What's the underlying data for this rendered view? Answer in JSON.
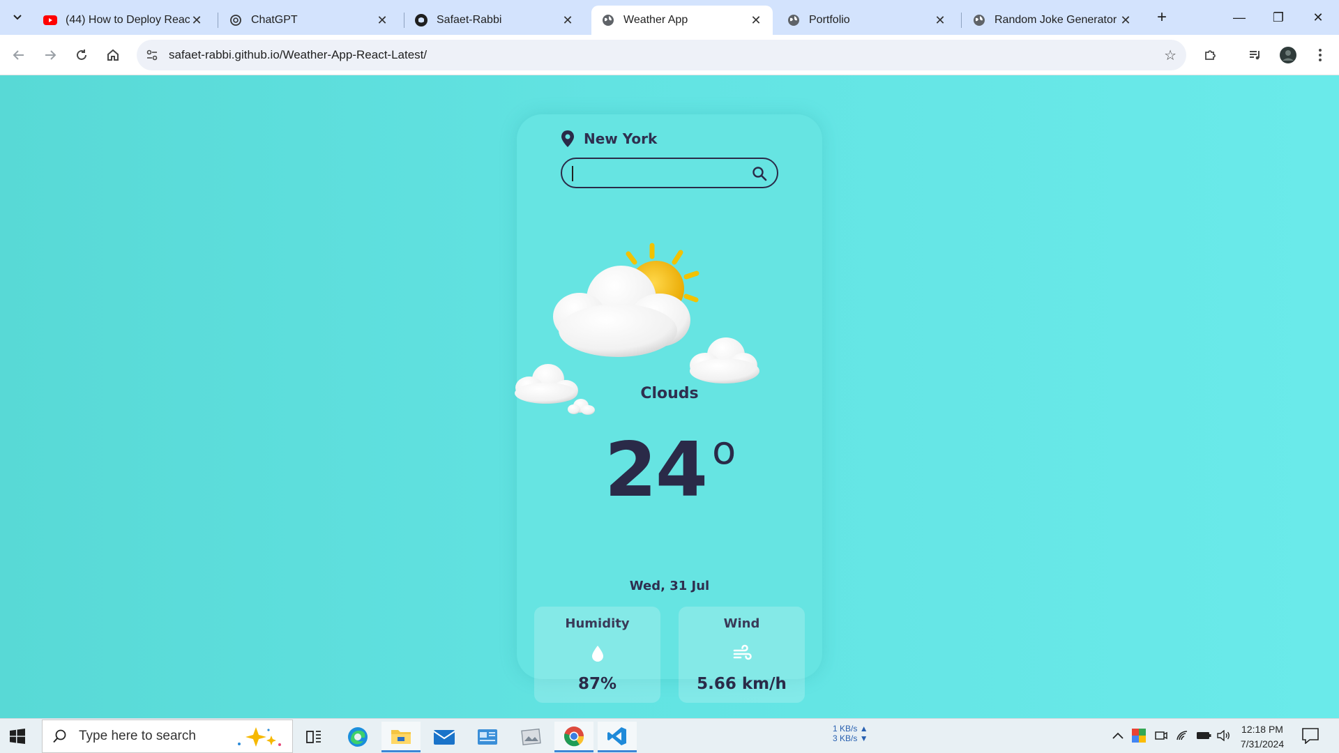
{
  "browser": {
    "tabs": [
      {
        "title": "(44) How to Deploy React /",
        "favicon": "youtube-icon",
        "active": false
      },
      {
        "title": "ChatGPT",
        "favicon": "chatgpt-icon",
        "active": false
      },
      {
        "title": "Safaet-Rabbi",
        "favicon": "github-icon",
        "active": false
      },
      {
        "title": "Weather App",
        "favicon": "globe-icon",
        "active": true
      },
      {
        "title": "Portfolio",
        "favicon": "globe-icon",
        "active": false
      },
      {
        "title": "Random Joke Generator",
        "favicon": "globe-icon",
        "active": false
      }
    ],
    "url": "safaet-rabbi.github.io/Weather-App-React-Latest/"
  },
  "weather": {
    "city": "New York",
    "search": {
      "value": "",
      "placeholder": ""
    },
    "condition": "Clouds",
    "temperature": "24",
    "degree_symbol": "o",
    "date": "Wed, 31 Jul",
    "humidity": {
      "label": "Humidity",
      "value": "87%"
    },
    "wind": {
      "label": "Wind",
      "value": "5.66 km/h"
    }
  },
  "taskbar": {
    "search_placeholder": "Type here to search",
    "net_up": "1 KB/s",
    "net_down": "3 KB/s",
    "time": "12:18 PM",
    "date": "7/31/2024"
  },
  "colors": {
    "page_background": "#62e3e2",
    "card_background": "#66e4e2",
    "text_dark": "#2a2a48"
  }
}
